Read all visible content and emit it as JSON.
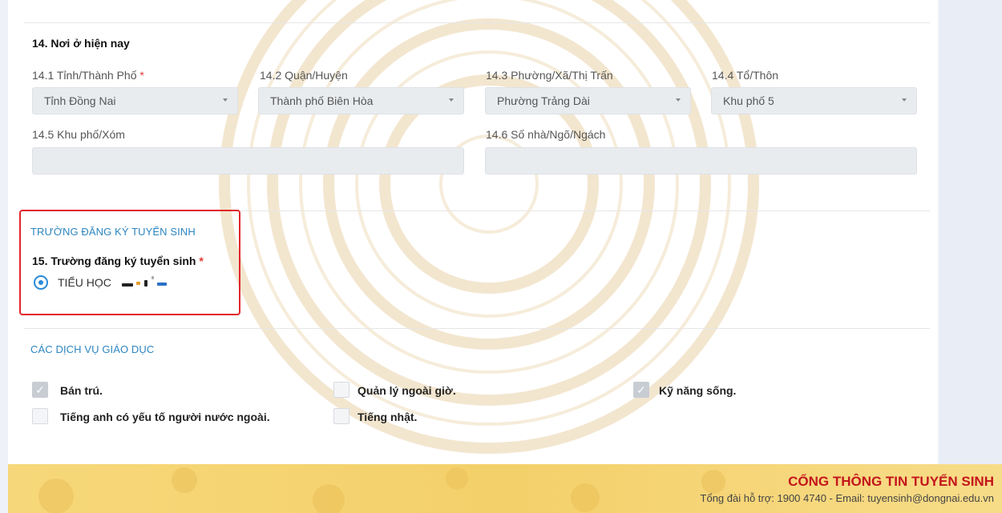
{
  "address": {
    "section_title": "14. Nơi ở hiện nay",
    "province": {
      "label": "14.1 Tỉnh/Thành Phố",
      "required": "*",
      "value": "Tỉnh Đồng Nai"
    },
    "district": {
      "label": "14.2 Quận/Huyện",
      "value": "Thành phố Biên Hòa"
    },
    "ward": {
      "label": "14.3 Phường/Xã/Thị Trấn",
      "value": "Phường Trảng Dài"
    },
    "hamlet": {
      "label": "14.4 Tổ/Thôn",
      "value": "Khu phố 5"
    },
    "quarter": {
      "label": "14.5 Khu phố/Xóm",
      "value": ""
    },
    "house": {
      "label": "14.6 Số nhà/Ngõ/Ngách",
      "value": ""
    }
  },
  "school": {
    "heading": "TRƯỜNG ĐĂNG KÝ TUYỂN SINH",
    "question": "15. Trường đăng ký tuyển sinh",
    "required": "*",
    "option_label": "TIỂU HỌC"
  },
  "services": {
    "heading": "CÁC DỊCH VỤ GIÁO DỤC",
    "items": [
      {
        "label": "Bán trú.",
        "checked": true
      },
      {
        "label": "Quản lý ngoài giờ.",
        "checked": false
      },
      {
        "label": "Kỹ năng sống.",
        "checked": true
      },
      {
        "label": "Tiếng anh có yếu tố người nước ngoài.",
        "checked": false
      },
      {
        "label": "Tiếng nhật.",
        "checked": false
      }
    ]
  },
  "footer": {
    "title": "CỔNG THÔNG TIN TUYỂN SINH",
    "subtitle": "Tổng đài hỗ trợ: 1900 4740 - Email: tuyensinh@dongnai.edu.vn"
  },
  "colors": {
    "accent_blue": "#2e86c1",
    "required_red": "#e53935",
    "highlight_box": "#e0262b",
    "footer_title": "#c3161c"
  },
  "icons": {
    "select_caret": "chevron-down-icon",
    "checkmark": "check-icon",
    "watermark": "bronze-drum-watermark"
  }
}
